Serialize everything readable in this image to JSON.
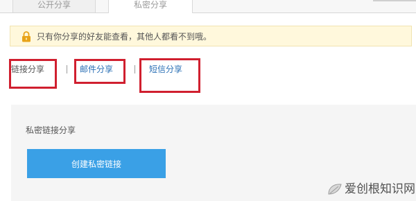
{
  "tabs": {
    "public_share": "公开分享",
    "private_share": "私密分享"
  },
  "notice": {
    "text": "只有你分享的好友能查看，其他人都看不到哦。"
  },
  "share_methods": {
    "link": "链接分享",
    "mail": "邮件分享",
    "sms": "短信分享",
    "separator": "|"
  },
  "panel": {
    "title": "私密链接分享",
    "create_button_label": "创建私密链接"
  },
  "watermark": {
    "text": "爱创根知识网"
  },
  "colors": {
    "accent_blue": "#3aa0e6",
    "link_blue": "#2a6fb5",
    "highlight_red": "#d01f2f",
    "notice_bg": "#fff8dc",
    "lock_orange": "#e8a319"
  }
}
